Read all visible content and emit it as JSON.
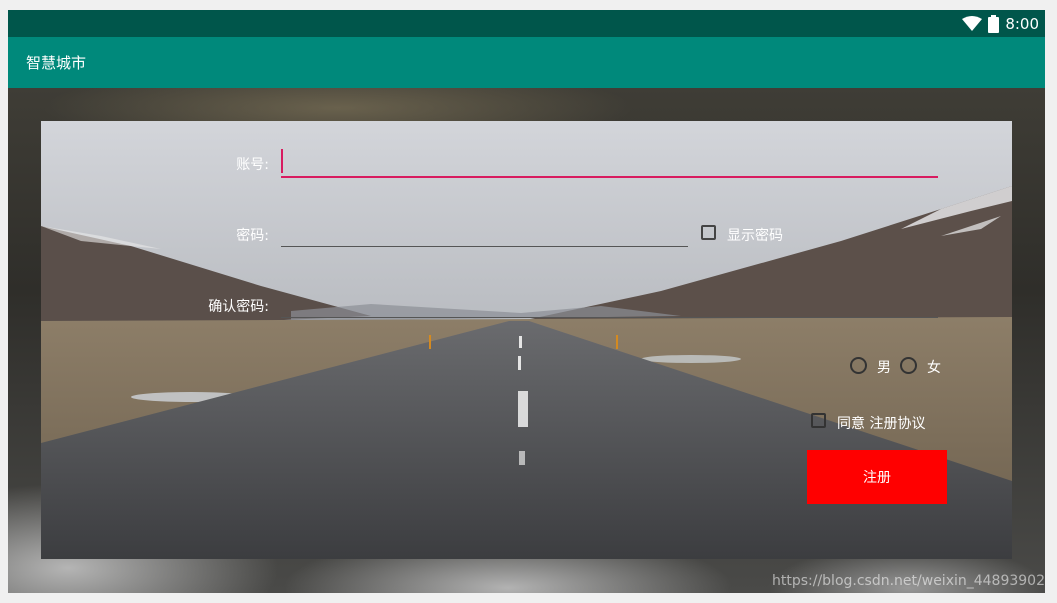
{
  "status_bar": {
    "time": "8:00",
    "icons": [
      "wifi-icon",
      "battery-icon"
    ]
  },
  "app_bar": {
    "title": "智慧城市"
  },
  "form": {
    "account_label": "账号:",
    "account_value": "",
    "password_label": "密码:",
    "password_value": "",
    "show_password_label": "显示密码",
    "show_password_checked": false,
    "confirm_label": "确认密码:",
    "confirm_value": "",
    "gender_options": [
      "男",
      "女"
    ],
    "agree_label": "同意 注册协议",
    "agree_checked": false,
    "register_button": "注册"
  },
  "watermark": "https://blog.csdn.net/weixin_44893902",
  "colors": {
    "status_bar": "#00564b",
    "app_bar": "#00897b",
    "accent": "#d81b60",
    "register_button": "#ff0000"
  }
}
